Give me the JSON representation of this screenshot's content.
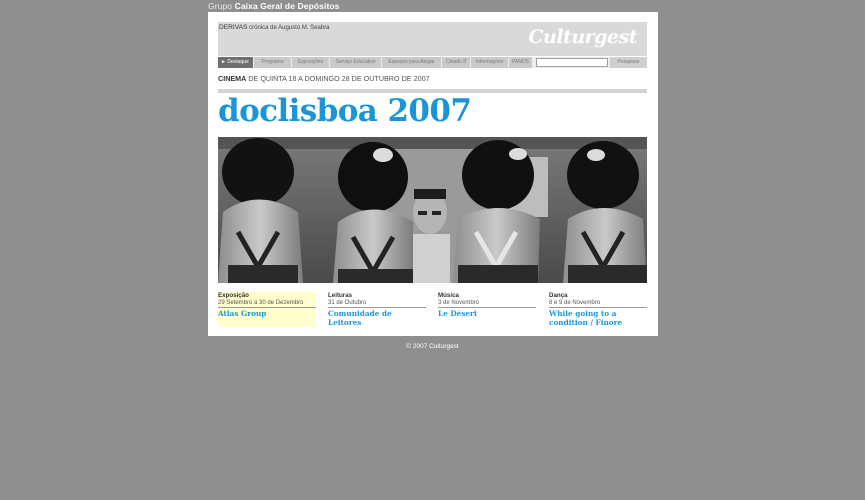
{
  "group_header": {
    "prefix": "Grupo",
    "name": "Caixa Geral de Depósitos"
  },
  "derivas": {
    "label": "DERIVAS",
    "text": "crónica de Augusto M. Seabra"
  },
  "logo": {
    "text": "Culturgest"
  },
  "nav": {
    "items": [
      {
        "label": "Destaque",
        "active": true
      },
      {
        "label": "Programa"
      },
      {
        "label": "Exposições"
      },
      {
        "label": "Serviço Educativo"
      },
      {
        "label": "Espaços para Alugar"
      },
      {
        "label": "Chiado 8"
      },
      {
        "label": "Informações"
      },
      {
        "label": "PANOS"
      }
    ],
    "search_value": "",
    "search_button": "Pesquisar"
  },
  "cinema": {
    "category": "CINEMA",
    "dates": "DE QUINTA 18 A DOMINGO 28 DE OUTUBRO DE 2007"
  },
  "main_title": "doclisboa 2007",
  "events": [
    {
      "category": "Exposição",
      "date": "29 Setembro a 30 de Dezembro",
      "name": "Atlas Group",
      "highlight": true
    },
    {
      "category": "Leituras",
      "date": "31 de Outubro",
      "name": "Comunidade de Leitores"
    },
    {
      "category": "Música",
      "date": "3 de Novembro",
      "name": "Le Désert"
    },
    {
      "category": "Dança",
      "date": "8 e 9 de Novembro",
      "name": "While going to a condition / Finore"
    }
  ],
  "footer": "© 2007 Culturgest"
}
